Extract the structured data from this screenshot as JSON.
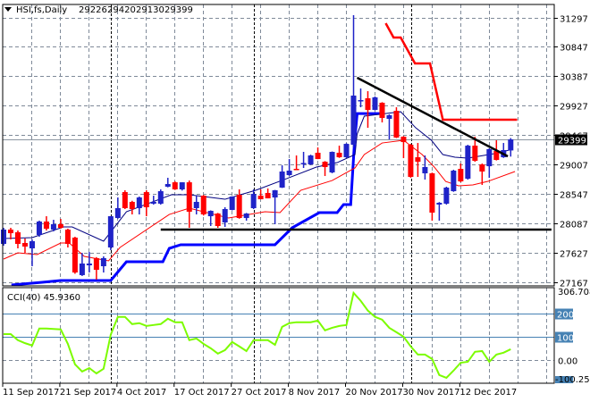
{
  "chart_data": {
    "type": "candlestick",
    "symbol": "HSI,fs,Daily",
    "header": {
      "title": "HSI,fs,Daily",
      "open": "29226",
      "high": "29420",
      "low": "29130",
      "close": "29399"
    },
    "current_price_label": "29399",
    "current_price": 29399,
    "price_axis": {
      "ylim": [
        27167,
        31297
      ],
      "ticks": [
        "31297",
        "30847",
        "30387",
        "29927",
        "29467",
        "29007",
        "28547",
        "28087",
        "27627",
        "27167"
      ],
      "tick_values": [
        31297,
        30847,
        30387,
        29927,
        29467,
        29007,
        28547,
        28087,
        27627,
        27167
      ]
    },
    "date_labels": [
      "11 Sep 2017",
      "21 Sep 2017",
      "4 Oct 2017",
      "17 Oct 2017",
      "27 Oct 2017",
      "8 Nov 2017",
      "20 Nov 2017",
      "30 Nov 2017",
      "12 Dec 2017"
    ],
    "date_label_candle_index": [
      0,
      8,
      16,
      24,
      32,
      40,
      48,
      56,
      64
    ],
    "month_separator_candle_index": [
      15,
      35,
      57.1
    ],
    "candles_ohlc": [
      [
        27767,
        28018,
        27739,
        27990
      ],
      [
        27990,
        28018,
        27837,
        27934
      ],
      [
        27948,
        27976,
        27697,
        27767
      ],
      [
        27781,
        27851,
        27627,
        27725
      ],
      [
        27697,
        27837,
        27418,
        27809
      ],
      [
        27906,
        28130,
        27878,
        28116
      ],
      [
        28116,
        28199,
        27976,
        28004
      ],
      [
        27990,
        28143,
        27962,
        28074
      ],
      [
        28074,
        28157,
        28004,
        28018
      ],
      [
        27990,
        28004,
        27711,
        27767
      ],
      [
        27865,
        27878,
        27300,
        27320
      ],
      [
        27279,
        27627,
        27265,
        27460
      ],
      [
        27432,
        27640,
        27320,
        27460
      ],
      [
        27544,
        27560,
        27209,
        27362
      ],
      [
        27418,
        27572,
        27320,
        27544
      ],
      [
        27711,
        28199,
        27669,
        28199
      ],
      [
        28171,
        28492,
        28160,
        28325
      ],
      [
        28576,
        28604,
        28311,
        28325
      ],
      [
        28423,
        28440,
        28227,
        28311
      ],
      [
        28325,
        28506,
        28227,
        28492
      ],
      [
        28576,
        28604,
        28199,
        28339
      ],
      [
        28395,
        28520,
        28380,
        28423
      ],
      [
        28395,
        28618,
        28380,
        28590
      ],
      [
        28660,
        28799,
        28650,
        28702
      ],
      [
        28729,
        28745,
        28610,
        28618
      ],
      [
        28618,
        28729,
        28600,
        28729
      ],
      [
        28729,
        28757,
        28018,
        28269
      ],
      [
        28325,
        28520,
        28227,
        28423
      ],
      [
        28520,
        28530,
        28210,
        28227
      ],
      [
        28199,
        28290,
        28046,
        28283
      ],
      [
        28241,
        28250,
        28018,
        28046
      ],
      [
        28102,
        28339,
        28032,
        28311
      ],
      [
        28297,
        28510,
        28290,
        28506
      ],
      [
        28534,
        28618,
        28160,
        28171
      ],
      [
        28171,
        28250,
        28130,
        28241
      ],
      [
        28325,
        28618,
        28310,
        28548
      ],
      [
        28520,
        28618,
        28464,
        28464
      ],
      [
        28562,
        28632,
        28478,
        28478
      ],
      [
        28492,
        28610,
        28074,
        28604
      ],
      [
        28646,
        28994,
        28640,
        28897
      ],
      [
        28841,
        29092,
        28830,
        28911
      ],
      [
        28939,
        29148,
        28920,
        28925
      ],
      [
        29015,
        29204,
        28953,
        29030
      ],
      [
        29008,
        29160,
        29000,
        29148
      ],
      [
        29190,
        29273,
        29090,
        29092
      ],
      [
        29050,
        29060,
        28827,
        28967
      ],
      [
        28883,
        29210,
        28870,
        29204
      ],
      [
        29190,
        29301,
        29110,
        29120
      ],
      [
        29120,
        29340,
        29110,
        29329
      ],
      [
        29315,
        31338,
        29273,
        30083
      ],
      [
        30000,
        30194,
        29901,
        30013
      ],
      [
        30041,
        30152,
        29580,
        29859
      ],
      [
        29859,
        30070,
        29850,
        30055
      ],
      [
        29971,
        29980,
        29664,
        29734
      ],
      [
        29720,
        29790,
        29399,
        29776
      ],
      [
        29845,
        29901,
        29420,
        29427
      ],
      [
        29441,
        29450,
        29106,
        29357
      ],
      [
        29315,
        29330,
        28800,
        28813
      ],
      [
        29120,
        29343,
        28813,
        29050
      ],
      [
        28869,
        29148,
        28771,
        28967
      ],
      [
        28869,
        28880,
        28130,
        28255
      ],
      [
        28381,
        28420,
        28130,
        28409
      ],
      [
        28395,
        28660,
        28380,
        28646
      ],
      [
        28590,
        28925,
        28580,
        28911
      ],
      [
        28939,
        29022,
        28730,
        28743
      ],
      [
        28785,
        29315,
        28770,
        29301
      ],
      [
        29301,
        29441,
        29050,
        29064
      ],
      [
        29008,
        29022,
        28688,
        28897
      ],
      [
        28980,
        29260,
        28799,
        29246
      ],
      [
        29218,
        29385,
        29070,
        29078
      ],
      [
        29120,
        29343,
        29110,
        29232
      ],
      [
        29226,
        29420,
        29130,
        29399
      ]
    ],
    "overlays": {
      "fast_ma": [
        [
          0,
          27851
        ],
        [
          4,
          27865
        ],
        [
          8.4,
          28032
        ],
        [
          9.6,
          28032
        ],
        [
          14,
          27809
        ],
        [
          17.2,
          28269
        ],
        [
          23.5,
          28534
        ],
        [
          26,
          28534
        ],
        [
          31,
          28464
        ],
        [
          35.3,
          28604
        ],
        [
          39.6,
          28785
        ],
        [
          43.8,
          28967
        ],
        [
          46.7,
          29036
        ],
        [
          49.2,
          29162
        ],
        [
          49.5,
          29483
        ],
        [
          50.5,
          29762
        ],
        [
          55.6,
          29831
        ],
        [
          57.7,
          29580
        ],
        [
          59.9,
          29385
        ],
        [
          61.5,
          29162
        ],
        [
          63.2,
          29120
        ],
        [
          65,
          29106
        ],
        [
          68.7,
          29176
        ],
        [
          70.8,
          29232
        ]
      ],
      "slow_ma": [
        [
          0,
          27530
        ],
        [
          2,
          27627
        ],
        [
          4.7,
          27600
        ],
        [
          8,
          27781
        ],
        [
          9.2,
          27781
        ],
        [
          11.3,
          27572
        ],
        [
          14.7,
          27502
        ],
        [
          16.3,
          27711
        ],
        [
          23.2,
          28227
        ],
        [
          26,
          28325
        ],
        [
          31.5,
          28171
        ],
        [
          36.6,
          28269
        ],
        [
          38.7,
          28255
        ],
        [
          41.6,
          28604
        ],
        [
          46,
          28757
        ],
        [
          49.2,
          28953
        ],
        [
          50.5,
          29162
        ],
        [
          53,
          29343
        ],
        [
          56,
          29385
        ],
        [
          58.6,
          29162
        ],
        [
          60.3,
          28967
        ],
        [
          61.9,
          28743
        ],
        [
          63.7,
          28674
        ],
        [
          65.7,
          28688
        ],
        [
          67.8,
          28743
        ],
        [
          71.6,
          28897
        ]
      ],
      "support_step": [
        [
          1.1,
          27125
        ],
        [
          5.4,
          27167
        ],
        [
          8,
          27195
        ],
        [
          15,
          27195
        ],
        [
          17.2,
          27488
        ],
        [
          22.3,
          27488
        ],
        [
          23.2,
          27697
        ],
        [
          24.8,
          27753
        ],
        [
          38,
          27753
        ],
        [
          40.4,
          28018
        ],
        [
          44.2,
          28255
        ],
        [
          46.7,
          28255
        ],
        [
          47.6,
          28381
        ],
        [
          48.6,
          28381
        ],
        [
          49.1,
          29301
        ],
        [
          49.5,
          29803
        ],
        [
          52.7,
          29803
        ]
      ],
      "resistance_step": [
        [
          53.5,
          31213
        ],
        [
          54.6,
          30990
        ],
        [
          55.6,
          30990
        ],
        [
          57.6,
          30585
        ],
        [
          59.7,
          30585
        ],
        [
          61.5,
          29706
        ],
        [
          71.9,
          29706
        ]
      ],
      "trendline": [
        [
          49.5,
          30362
        ],
        [
          70.6,
          29134
        ]
      ],
      "horizontal_line": {
        "price": 27990,
        "from_index": 22,
        "to_index": 76.7
      }
    },
    "cci": {
      "label": "CCI(40) 45.9360",
      "period": 40,
      "value": 45.936,
      "ylim": [
        -100.258,
        306.7083
      ],
      "axis_labels": {
        "max": "306.7083",
        "l200": "200",
        "l100": "100",
        "zero": "0.00",
        "min": "-100.258"
      },
      "levels": [
        200,
        100
      ],
      "values": [
        111,
        111,
        85,
        72,
        62,
        135,
        135,
        133,
        131,
        69,
        -19,
        -50,
        -35,
        -58,
        -38,
        108,
        185,
        185,
        154,
        158,
        146,
        150,
        154,
        177,
        162,
        162,
        85,
        92,
        69,
        50,
        27,
        42,
        77,
        58,
        38,
        85,
        85,
        85,
        65,
        142,
        158,
        162,
        162,
        162,
        169,
        127,
        138,
        146,
        150,
        288,
        254,
        212,
        185,
        173,
        138,
        119,
        100,
        58,
        23,
        23,
        4,
        -65,
        -77,
        -46,
        -12,
        -8,
        35,
        38,
        -8,
        23,
        31,
        45.936
      ]
    },
    "colors": {
      "up": "#1f23c8",
      "down": "#ff0000",
      "fast_ma": "#000080",
      "slow_ma": "#ff0000",
      "support": "#0000ff",
      "resistance": "#ff0000",
      "trend": "#000000",
      "cci": "#7cfc00",
      "cci_levels": "#4682b4",
      "grid": "#7f8a99"
    }
  }
}
